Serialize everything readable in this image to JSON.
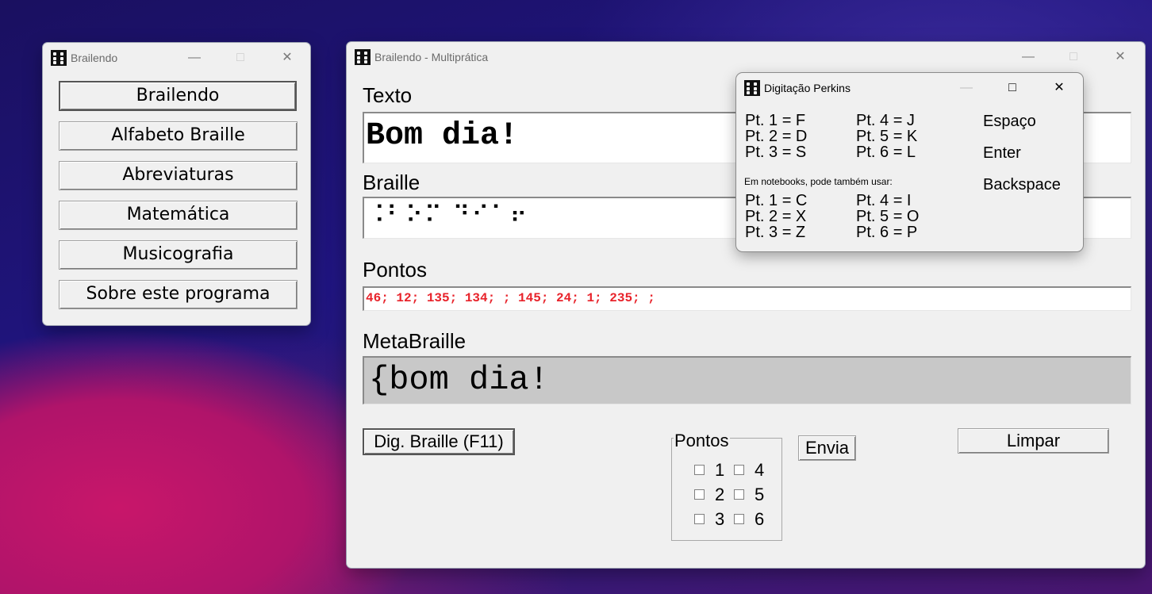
{
  "menu_window": {
    "title": "Brailendo",
    "buttons": [
      "Brailendo",
      "Alfabeto Braille",
      "Abreviaturas",
      "Matemática",
      "Musicografia",
      "Sobre este programa"
    ]
  },
  "main_window": {
    "title": "Brailendo - Multiprática",
    "texto_label": "Texto",
    "texto_value": "Bom dia!",
    "braille_label": "Braille",
    "braille_value": "⠨⠃⠕⠍ ⠙⠊⠁⠖",
    "pontos_label": "Pontos",
    "pontos_value": "46; 12; 135; 134; ; 145; 24; 1; 235; ;",
    "metabraille_label": "MetaBraille",
    "metabraille_value": "{bom dia!",
    "dig_button": "Dig. Braille (F11)",
    "group_title": "Pontos",
    "checkboxes": [
      "1",
      "4",
      "2",
      "5",
      "3",
      "6"
    ],
    "envia_button": "Envia",
    "limpar_button": "Limpar"
  },
  "perkins_window": {
    "title": "Digitação Perkins",
    "col1": [
      "Pt. 1 = F",
      "Pt. 2 = D",
      "Pt. 3 = S"
    ],
    "col2": [
      "Pt. 4 = J",
      "Pt. 5 = K",
      "Pt. 6 = L"
    ],
    "keys": [
      "Espaço",
      "Enter",
      "Backspace"
    ],
    "note": "Em notebooks, pode também usar:",
    "alt_col1": [
      "Pt. 1 = C",
      "Pt. 2 = X",
      "Pt. 3 = Z"
    ],
    "alt_col2": [
      "Pt. 4 = I",
      "Pt. 5 = O",
      "Pt. 6 = P"
    ]
  },
  "colors": {
    "pontos_text": "#e8232b",
    "metabraille_bg": "#c8c8c8"
  },
  "icons": [
    "braille-app-icon",
    "minimize-icon",
    "maximize-icon",
    "close-icon"
  ]
}
